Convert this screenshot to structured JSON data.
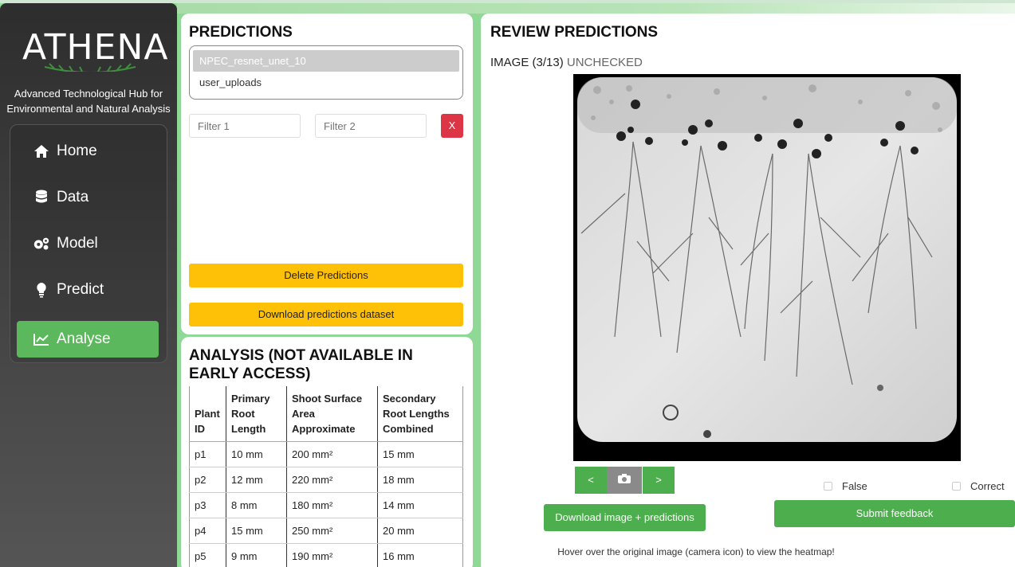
{
  "brand": {
    "logo_text": "ATHENA",
    "tagline_line1": "Advanced Technological Hub for",
    "tagline_line2": "Environmental and Natural Analysis"
  },
  "nav": {
    "items": [
      {
        "label": "Home",
        "icon": "home-icon"
      },
      {
        "label": "Data",
        "icon": "database-icon"
      },
      {
        "label": "Model",
        "icon": "gears-icon"
      },
      {
        "label": "Predict",
        "icon": "lightbulb-icon"
      },
      {
        "label": "Analyse",
        "icon": "chart-line-icon",
        "active": true
      }
    ]
  },
  "predictions": {
    "title": "PREDICTIONS",
    "options": [
      "NPEC_resnet_unet_10",
      "user_uploads"
    ],
    "selected": "NPEC_resnet_unet_10",
    "filter1_placeholder": "Filter 1",
    "filter2_placeholder": "Filter 2",
    "clear_label": "X",
    "delete_label": "Delete Predictions",
    "download_label": "Download predictions dataset"
  },
  "analysis": {
    "title_line1": "ANALYSIS (NOT AVAILABLE IN",
    "title_line2": "EARLY ACCESS)",
    "columns": [
      [
        "Plant",
        "ID"
      ],
      [
        "Primary",
        "Root",
        "Length"
      ],
      [
        "Shoot Surface",
        "Area",
        "Approximate"
      ],
      [
        "Secondary",
        "Root Lengths",
        "Combined"
      ]
    ],
    "rows": [
      [
        "p1",
        "10 mm",
        "200 mm²",
        "15 mm"
      ],
      [
        "p2",
        "12 mm",
        "220 mm²",
        "18 mm"
      ],
      [
        "p3",
        "8 mm",
        "180 mm²",
        "14 mm"
      ],
      [
        "p4",
        "15 mm",
        "250 mm²",
        "20 mm"
      ],
      [
        "p5",
        "9 mm",
        "190 mm²",
        "16 mm"
      ]
    ]
  },
  "review": {
    "title": "REVIEW PREDICTIONS",
    "image_label": "IMAGE (3/13)",
    "image_status": "UNCHECKED",
    "prev_label": "<",
    "next_label": ">",
    "download_label": "Download image + predictions",
    "false_label": "False",
    "correct_label": "Correct",
    "submit_label": "Submit feedback",
    "hint": "Hover over the original image (camera icon) to view the heatmap!"
  },
  "colors": {
    "accent_green": "#4cae4c",
    "danger": "#dc3545",
    "warning": "#ffc107"
  }
}
